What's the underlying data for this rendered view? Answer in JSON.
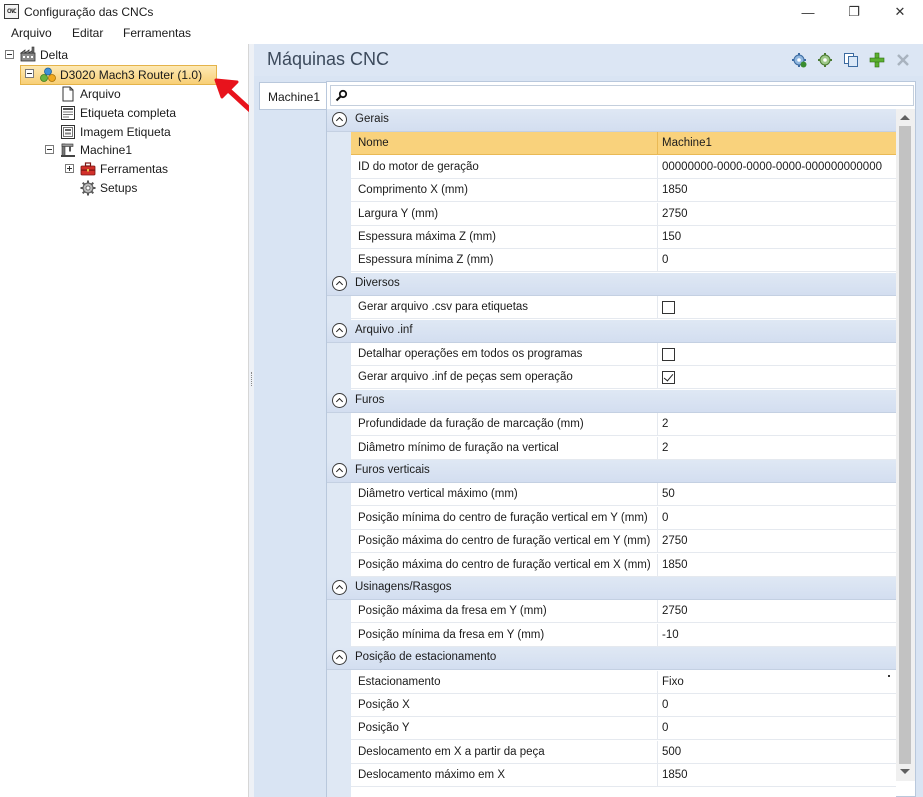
{
  "window": {
    "title": "Configuração das CNCs",
    "app_icon_text": "CNC",
    "minimize_glyph": "—",
    "maximize_glyph": "❐",
    "close_glyph": "✕"
  },
  "menu": [
    "Arquivo",
    "Editar",
    "Ferramentas"
  ],
  "tree": {
    "root": "Delta",
    "router": "D3020 Mach3 Router (1.0)",
    "items": [
      "Arquivo",
      "Etiqueta completa",
      "Imagem Etiqueta"
    ],
    "machine": "Machine1",
    "machine_children": [
      "Ferramentas",
      "Setups"
    ]
  },
  "panel": {
    "title": "Máquinas CNC",
    "toolbar_icons": [
      "gear-add-icon",
      "gear-copy-icon",
      "copy-icon",
      "plus-icon",
      "x-icon"
    ],
    "tab": "Machine1",
    "search_icon": "search-icon"
  },
  "properties": {
    "categories": [
      {
        "name": "Gerais",
        "rows": [
          {
            "name": "Nome",
            "value": "Machine1",
            "selected": true
          },
          {
            "name": "ID do motor de geração",
            "value": "00000000-0000-0000-0000-000000000000"
          },
          {
            "name": "Comprimento X (mm)",
            "value": "1850"
          },
          {
            "name": "Largura Y (mm)",
            "value": "2750"
          },
          {
            "name": "Espessura máxima Z (mm)",
            "value": "150"
          },
          {
            "name": "Espessura mínima Z (mm)",
            "value": "0"
          }
        ]
      },
      {
        "name": "Diversos",
        "rows": [
          {
            "name": "Gerar arquivo .csv para etiquetas",
            "checkbox": true,
            "checked": false
          }
        ]
      },
      {
        "name": "Arquivo .inf",
        "rows": [
          {
            "name": "Detalhar operações em todos os programas",
            "checkbox": true,
            "checked": false
          },
          {
            "name": "Gerar arquivo .inf de peças sem operação",
            "checkbox": true,
            "checked": true
          }
        ]
      },
      {
        "name": "Furos",
        "rows": [
          {
            "name": "Profundidade da furação de marcação (mm)",
            "value": "2"
          },
          {
            "name": "Diâmetro mínimo de furação na vertical",
            "value": "2"
          }
        ]
      },
      {
        "name": "Furos verticais",
        "rows": [
          {
            "name": "Diâmetro vertical máximo (mm)",
            "value": "50"
          },
          {
            "name": "Posição mínima do centro de furação vertical em Y (mm)",
            "value": "0"
          },
          {
            "name": "Posição máxima do centro de furação vertical em Y (mm)",
            "value": "2750"
          },
          {
            "name": "Posição máxima do centro de furação vertical em X (mm)",
            "value": "1850"
          }
        ]
      },
      {
        "name": "Usinagens/Rasgos",
        "rows": [
          {
            "name": "Posição máxima da fresa em Y (mm)",
            "value": "2750"
          },
          {
            "name": "Posição mínima da fresa em Y (mm)",
            "value": "-10"
          }
        ]
      },
      {
        "name": "Posição de estacionamento",
        "rows": [
          {
            "name": "Estacionamento",
            "value": "Fixo",
            "dropdown": true
          },
          {
            "name": "Posição X",
            "value": "0"
          },
          {
            "name": "Posição Y",
            "value": "0"
          },
          {
            "name": "Deslocamento em X a partir da peça",
            "value": "500"
          },
          {
            "name": "Deslocamento máximo em X",
            "value": "1850"
          }
        ]
      }
    ]
  }
}
